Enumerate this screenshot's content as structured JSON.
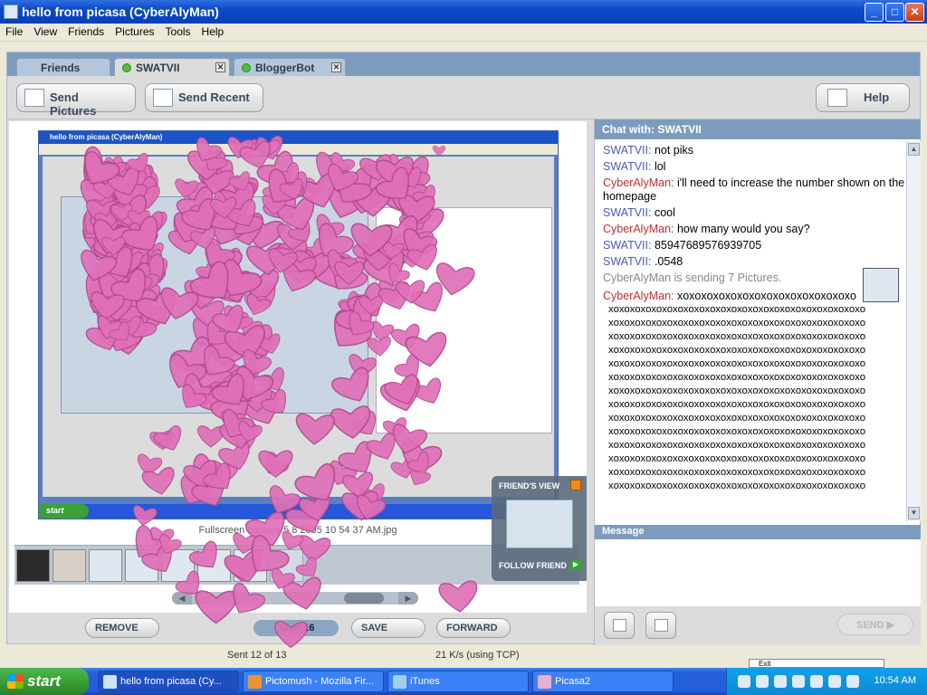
{
  "window": {
    "title": "hello from picasa (CyberAlyMan)",
    "minimize": "_",
    "maximize": "□",
    "close": "✕"
  },
  "menu": [
    "File",
    "View",
    "Friends",
    "Pictures",
    "Tools",
    "Help"
  ],
  "tabs": [
    {
      "label": "Friends"
    },
    {
      "label": "SWATVII"
    },
    {
      "label": "BloggerBot"
    }
  ],
  "toolbar": {
    "send_pictures": "Send Pictures",
    "send_recent": "Send Recent",
    "help": "Help"
  },
  "viewer": {
    "caption": "Fullscreen capture 5 8 2005 10 54 37 AM.jpg",
    "remove": "REMOVE",
    "counter": "12 of 16",
    "save": "SAVE",
    "forward": "FORWARD",
    "arrow_left": "◀",
    "arrow_right": "▶"
  },
  "friends_view": {
    "label": "FRIEND'S VIEW",
    "follow": "FOLLOW FRIEND"
  },
  "chat": {
    "header": "Chat with: SWATVII",
    "messages": [
      {
        "who": "SWATVII:",
        "text": " not piks"
      },
      {
        "who": "SWATVII:",
        "text": " lol"
      },
      {
        "who": "CyberAlyMan:",
        "text": " i'll need to increase the number shown on the homepage"
      },
      {
        "who": "SWATVII:",
        "text": " cool"
      },
      {
        "who": "CyberAlyMan:",
        "text": " how many would you say?"
      },
      {
        "who": "SWATVII:",
        "text": " 85947689576939705"
      },
      {
        "who": "SWATVII:",
        "text": " .0548"
      }
    ],
    "notice": "CyberAlyMan is sending 7 Pictures.",
    "xo_who": "CyberAlyMan:",
    "xo_first": " xoxoxoxoxoxoxoxoxoxoxoxoxoxoxo",
    "xo_line": "xoxoxoxoxoxoxoxoxoxoxoxoxoxoxoxoxoxoxoxoxoxoxoxo",
    "message_label": "Message",
    "send": "SEND"
  },
  "status": {
    "sent": "Sent 12 of 13",
    "speed": "21 K/s (using TCP)"
  },
  "tooltip": "Exit",
  "taskbar": {
    "start": "start",
    "tasks": [
      "hello from picasa (Cy...",
      "Pictomush - Mozilla Fir...",
      "iTunes",
      "Picasa2"
    ],
    "clock": "10:54 AM"
  },
  "colors": {
    "hearts": "#e070b8",
    "swatvii": "#4a5bb8",
    "cyberalyman": "#c03030"
  }
}
